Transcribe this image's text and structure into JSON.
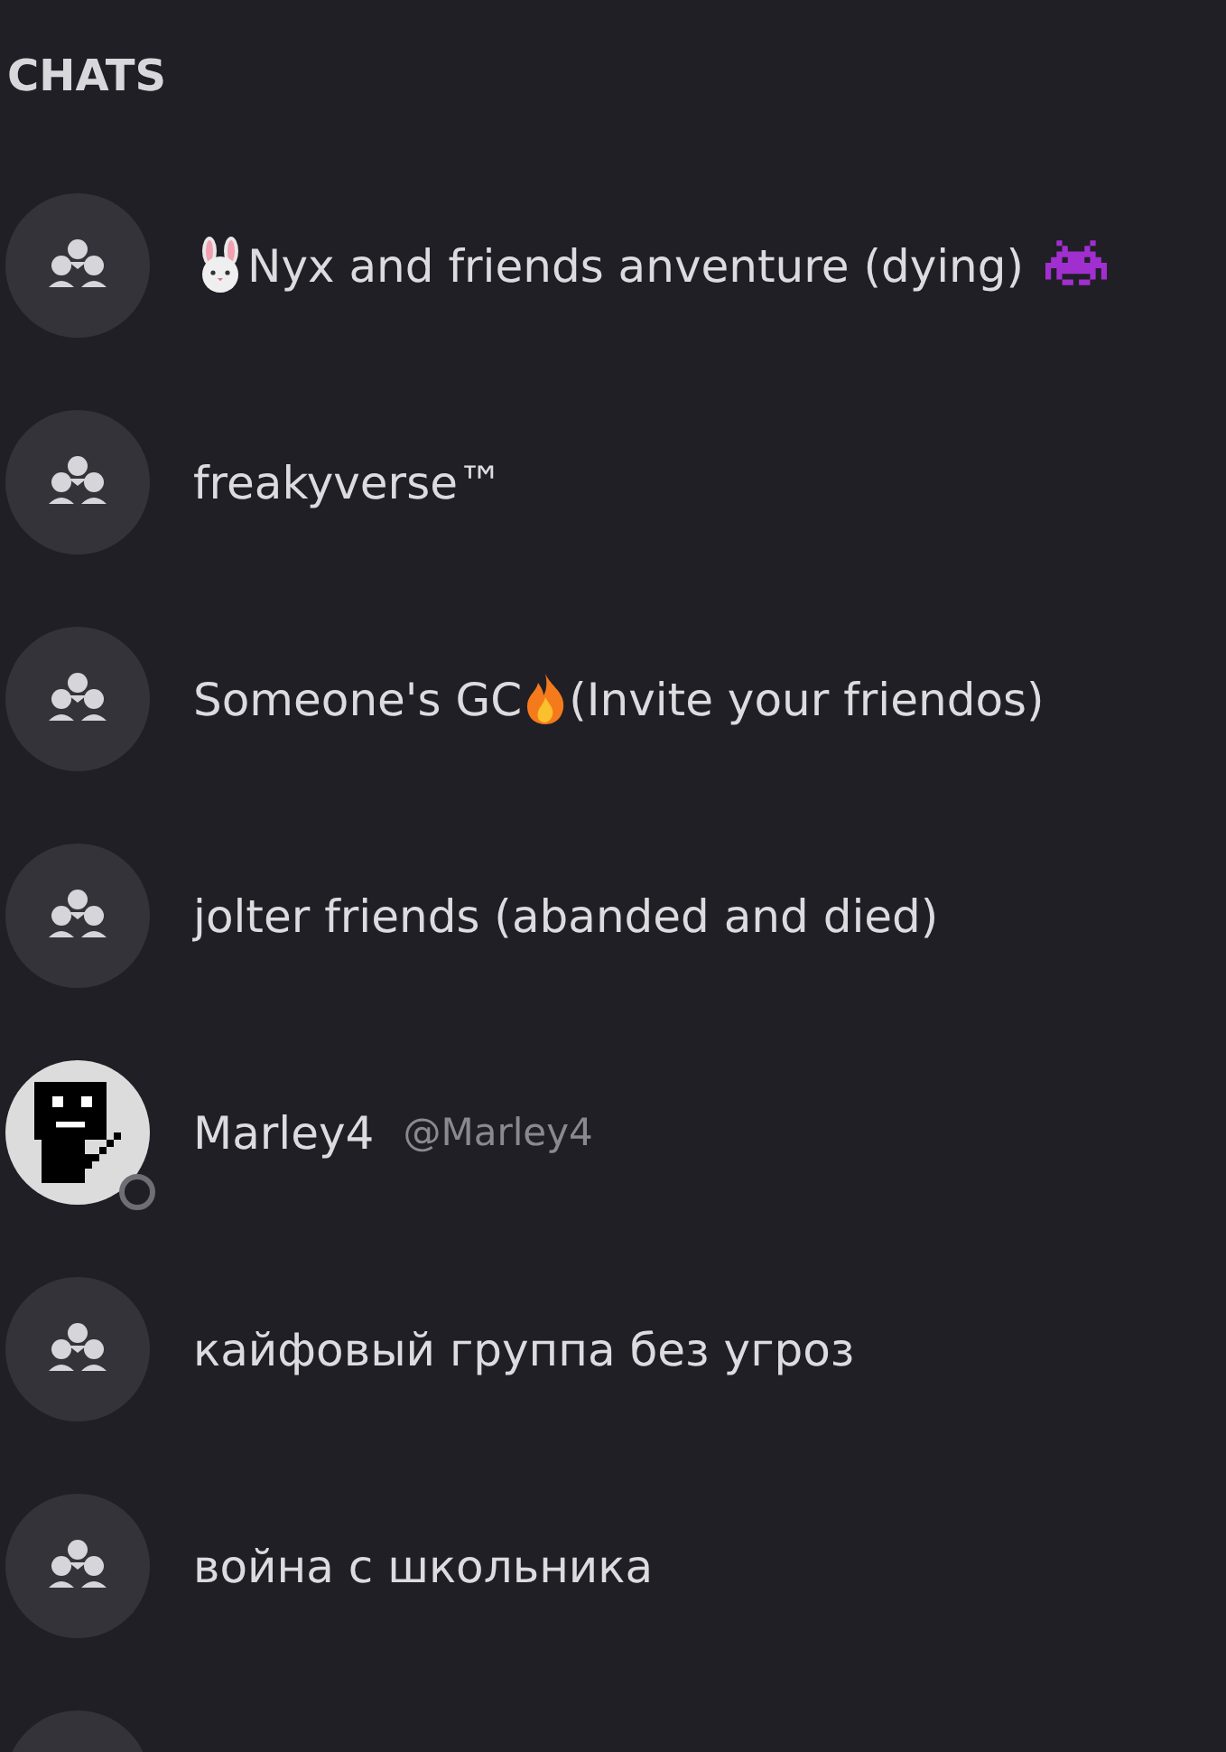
{
  "header": {
    "title": "CHATS"
  },
  "chats": [
    {
      "kind": "group",
      "segments": [
        {
          "kind": "rabbit"
        },
        {
          "kind": "text",
          "text": "Nyx and friends anventure (dying)"
        },
        {
          "kind": "invader"
        }
      ]
    },
    {
      "kind": "group",
      "segments": [
        {
          "kind": "text",
          "text": "freakyverse™"
        }
      ]
    },
    {
      "kind": "group",
      "segments": [
        {
          "kind": "text",
          "text": "Someone's GC"
        },
        {
          "kind": "flame"
        },
        {
          "kind": "text",
          "text": "(Invite your friendos)"
        }
      ]
    },
    {
      "kind": "group",
      "segments": [
        {
          "kind": "text",
          "text": "jolter friends (abanded and died)"
        }
      ]
    },
    {
      "kind": "user",
      "segments": [
        {
          "kind": "text",
          "text": "Marley4"
        }
      ],
      "handle": "@Marley4",
      "online": false
    },
    {
      "kind": "group",
      "segments": [
        {
          "kind": "text",
          "text": "кайфовый группа без угроз"
        }
      ]
    },
    {
      "kind": "group",
      "segments": [
        {
          "kind": "text",
          "text": "война с школьника"
        }
      ]
    },
    {
      "kind": "group"
    }
  ]
}
